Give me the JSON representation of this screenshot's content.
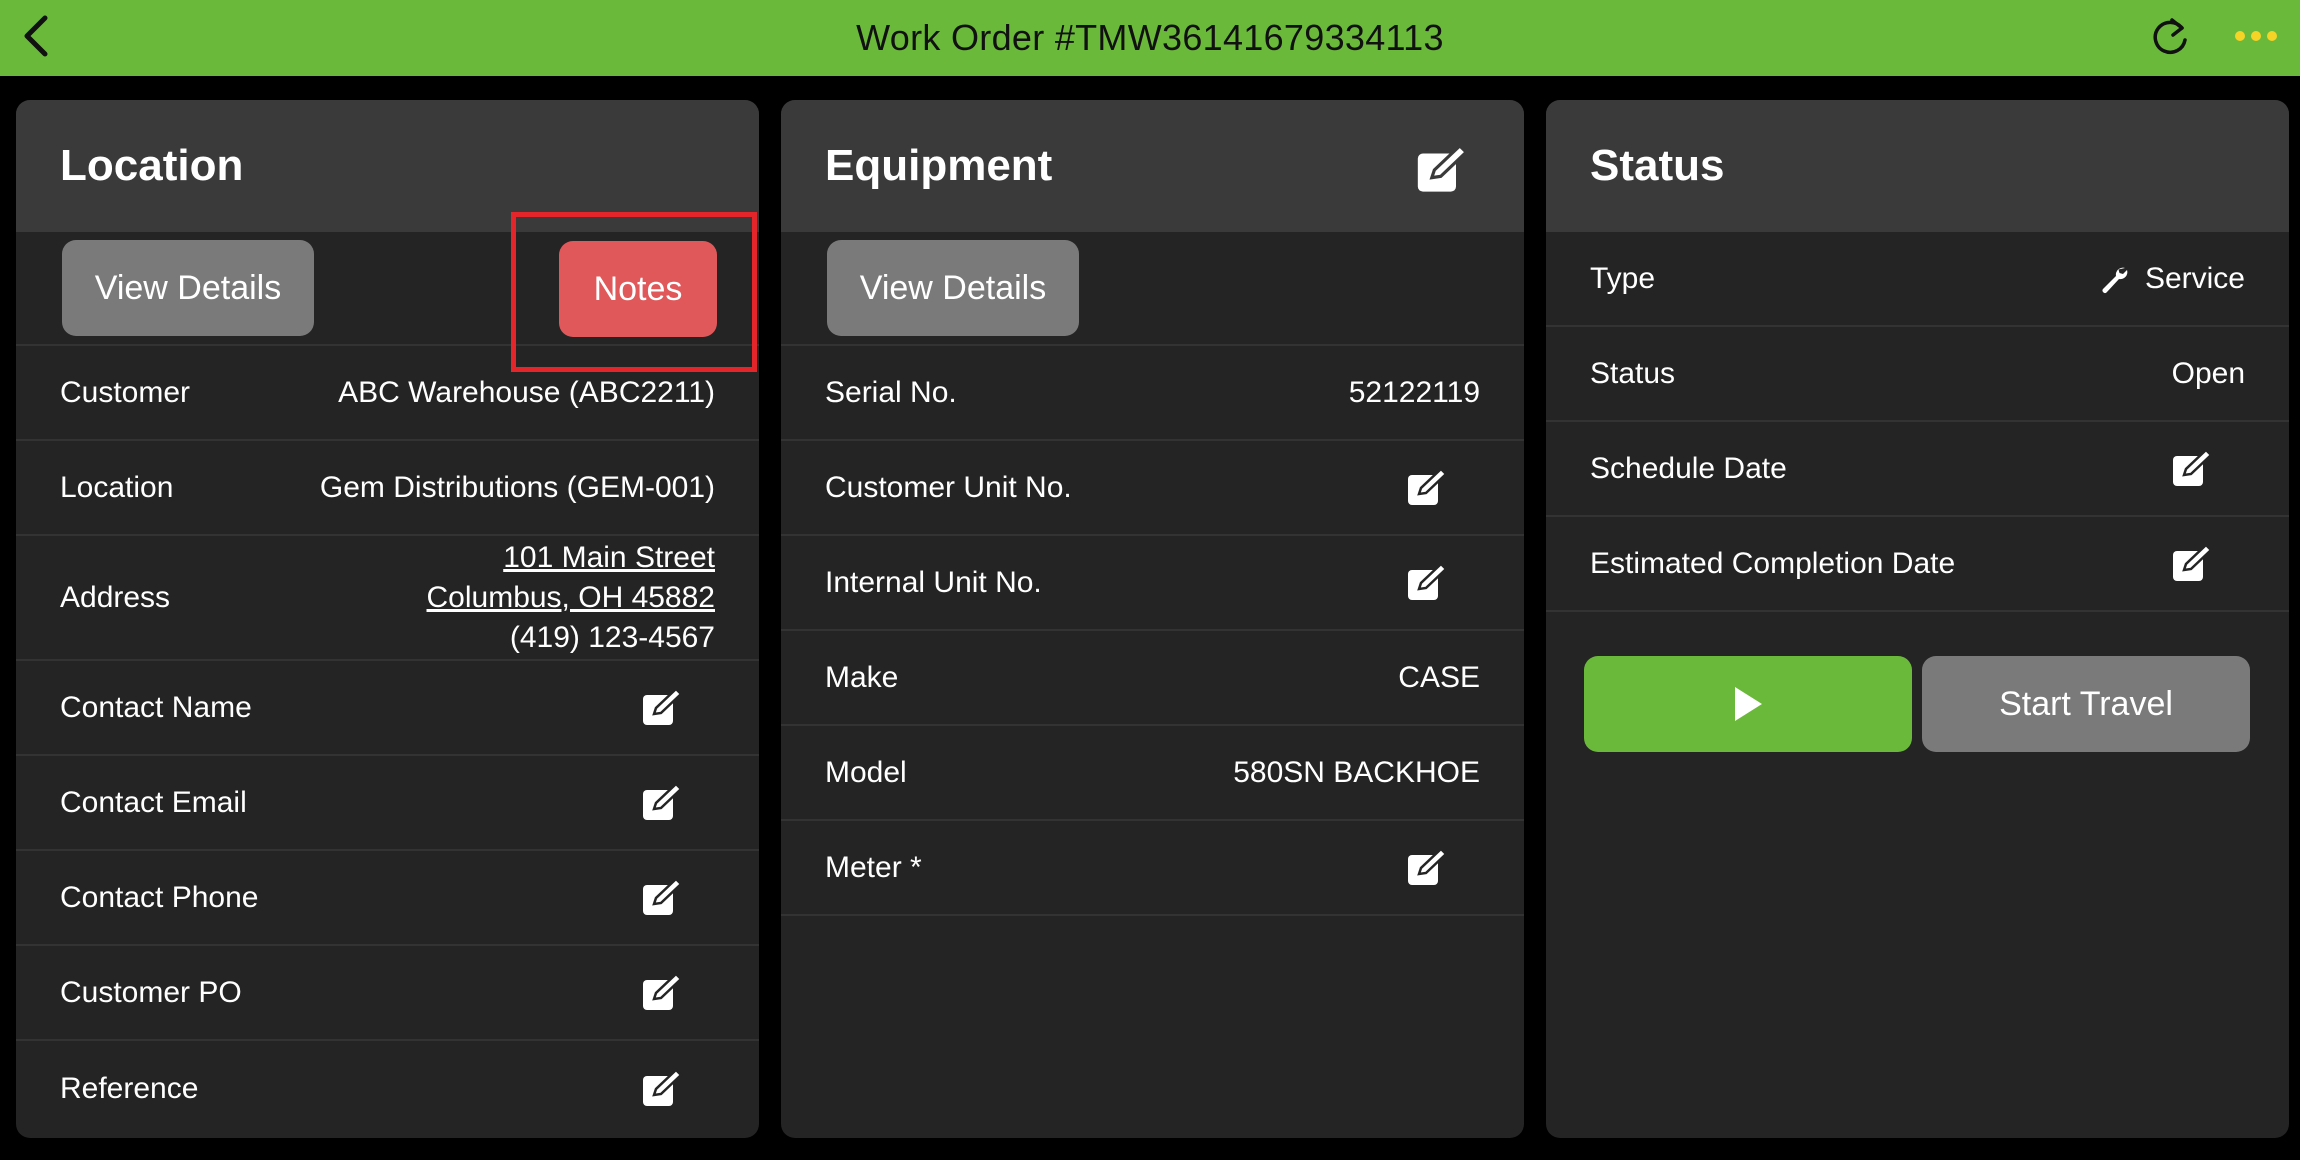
{
  "header": {
    "title": "Work Order #TMW36141679334113",
    "bar_color": "#6bb93a",
    "back_icon": "chevron-left-icon",
    "refresh_icon": "refresh-icon",
    "more_icon": "ellipsis-icon"
  },
  "location": {
    "title": "Location",
    "view_details_label": "View Details",
    "notes_label": "Notes",
    "notes_color": "#e0585a",
    "rows": {
      "customer": {
        "label": "Customer",
        "value": "ABC Warehouse (ABC2211)"
      },
      "location": {
        "label": "Location",
        "value": "Gem Distributions (GEM-001)"
      },
      "address": {
        "label": "Address",
        "line1": "101 Main Street",
        "line2": "Columbus, OH 45882",
        "phone": "(419) 123-4567"
      },
      "contact_name": {
        "label": "Contact Name"
      },
      "contact_email": {
        "label": "Contact Email"
      },
      "contact_phone": {
        "label": "Contact Phone"
      },
      "customer_po": {
        "label": "Customer PO"
      },
      "reference": {
        "label": "Reference"
      }
    }
  },
  "equipment": {
    "title": "Equipment",
    "view_details_label": "View Details",
    "rows": {
      "serial": {
        "label": "Serial No.",
        "value": "52122119"
      },
      "customer_unit": {
        "label": "Customer Unit No."
      },
      "internal_unit": {
        "label": "Internal Unit No."
      },
      "make": {
        "label": "Make",
        "value": "CASE"
      },
      "model": {
        "label": "Model",
        "value": "580SN BACKHOE"
      },
      "meter": {
        "label": "Meter *",
        "color": "#f0c419"
      }
    }
  },
  "status": {
    "title": "Status",
    "rows": {
      "type": {
        "label": "Type",
        "value": "Service",
        "icon": "wrench-icon"
      },
      "status": {
        "label": "Status",
        "value": "Open"
      },
      "schedule_date": {
        "label": "Schedule Date"
      },
      "est_completion": {
        "label": "Estimated Completion Date"
      }
    },
    "play_icon": "play-icon",
    "start_travel_label": "Start Travel"
  }
}
